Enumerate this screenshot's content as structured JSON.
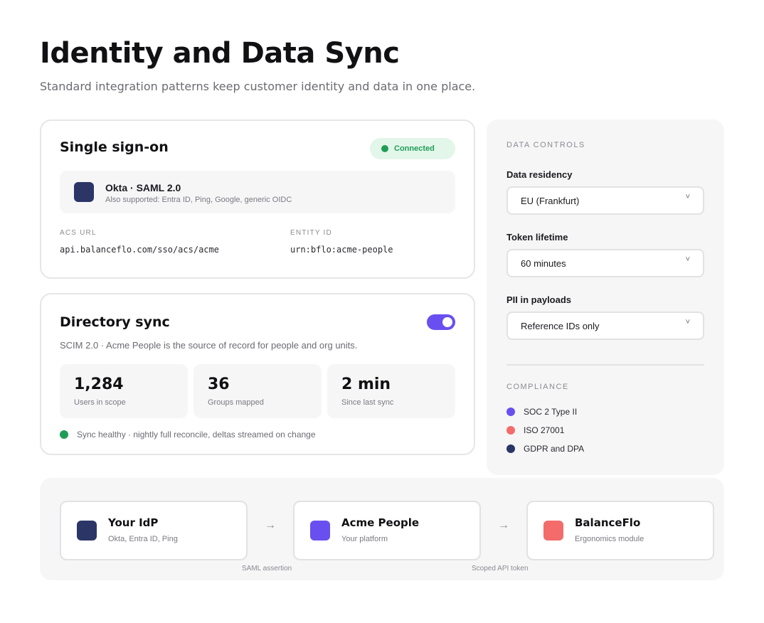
{
  "header": {
    "title": "Identity and Data Sync",
    "subtitle": "Standard integration patterns keep customer identity and data in one place."
  },
  "sso": {
    "title": "Single sign-on",
    "status": "Connected",
    "provider": {
      "name": "Okta · SAML 2.0",
      "also_supported": "Also supported: Entra ID, Ping, Google, generic OIDC"
    },
    "acs_label": "ACS URL",
    "acs_value": "api.balanceflo.com/sso/acs/acme",
    "entity_label": "ENTITY ID",
    "entity_value": "urn:bflo:acme-people"
  },
  "directory": {
    "title": "Directory sync",
    "enabled": true,
    "description": "SCIM 2.0 · Acme People is the source of record for people and org units.",
    "stats": [
      {
        "value": "1,284",
        "label": "Users in scope"
      },
      {
        "value": "36",
        "label": "Groups mapped"
      },
      {
        "value": "2 min",
        "label": "Since last sync"
      }
    ],
    "health": "Sync healthy · nightly full reconcile, deltas streamed on change"
  },
  "controls": {
    "section_label": "DATA CONTROLS",
    "residency_label": "Data residency",
    "residency_value": "EU (Frankfurt)",
    "token_label": "Token lifetime",
    "token_value": "60 minutes",
    "pii_label": "PII in payloads",
    "pii_value": "Reference IDs only",
    "compliance_label": "COMPLIANCE",
    "compliance": [
      {
        "label": "SOC 2 Type II",
        "color": "#6a4ff0"
      },
      {
        "label": "ISO 27001",
        "color": "#f36b6b"
      },
      {
        "label": "GDPR and DPA",
        "color": "#2b3566"
      }
    ]
  },
  "flow": {
    "nodes": [
      {
        "title": "Your IdP",
        "subtitle": "Okta, Entra ID, Ping",
        "color": "#2b3566"
      },
      {
        "title": "Acme People",
        "subtitle": "Your platform",
        "color": "#6a4ff0"
      },
      {
        "title": "BalanceFlo",
        "subtitle": "Ergonomics module",
        "color": "#f36b6b"
      }
    ],
    "edges": [
      {
        "label": "SAML assertion",
        "arrow": "→"
      },
      {
        "label": "Scoped API token",
        "arrow": "→"
      }
    ]
  }
}
